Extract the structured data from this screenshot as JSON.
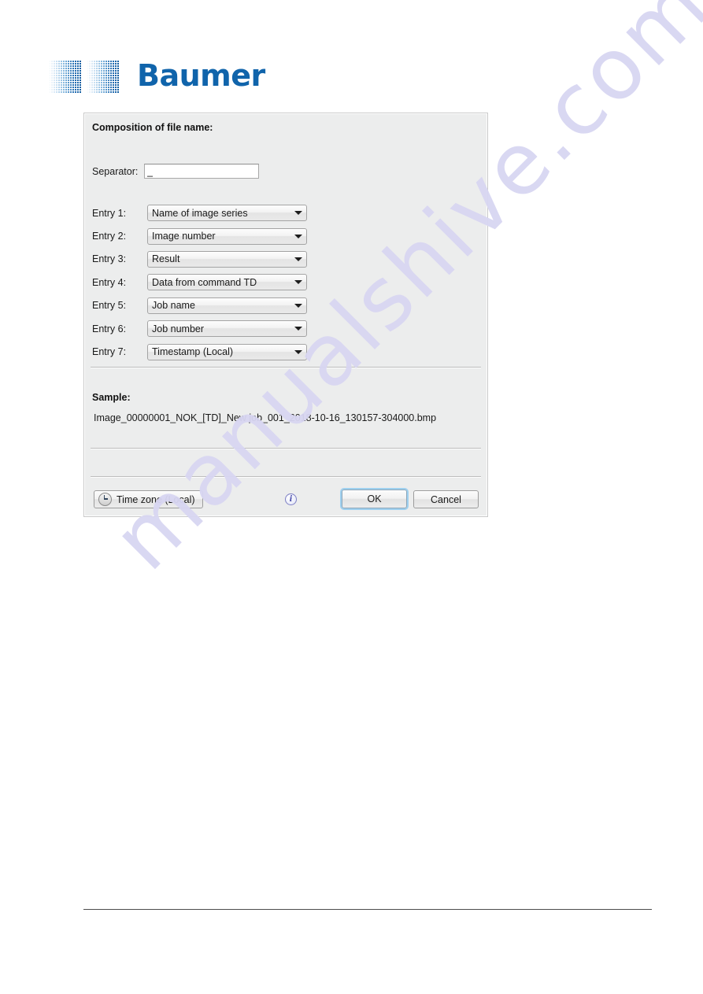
{
  "brand": {
    "name": "Baumer",
    "logo_color": "#1064ab"
  },
  "watermark": {
    "text": "manualshive.com",
    "color": "#d8d6f2"
  },
  "dialog": {
    "composition_title": "Composition of file name:",
    "separator": {
      "label": "Separator:",
      "value": "_"
    },
    "entries": [
      {
        "label": "Entry 1:",
        "value": "Name of image series"
      },
      {
        "label": "Entry 2:",
        "value": "Image number"
      },
      {
        "label": "Entry 3:",
        "value": "Result"
      },
      {
        "label": "Entry 4:",
        "value": "Data from command TD"
      },
      {
        "label": "Entry 5:",
        "value": "Job name"
      },
      {
        "label": "Entry 6:",
        "value": "Job number"
      },
      {
        "label": "Entry 7:",
        "value": "Timestamp (Local)"
      }
    ],
    "sample": {
      "title": "Sample:",
      "value": "Image_00000001_NOK_[TD]_New job_001_2018-10-16_130157-304000.bmp"
    },
    "buttons": {
      "timezone": "Time zone (Local)",
      "ok": "OK",
      "cancel": "Cancel"
    },
    "focus_ring_color": "#9ed0ef"
  }
}
